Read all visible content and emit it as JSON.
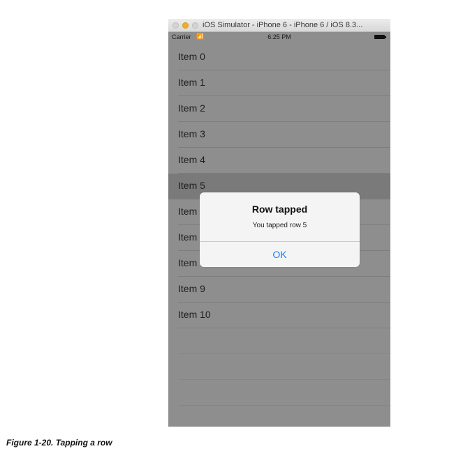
{
  "window": {
    "title": "iOS Simulator - iPhone 6 - iPhone 6 / iOS 8.3..."
  },
  "status_bar": {
    "carrier": "Carrier",
    "wifi_icon": "wifi-icon",
    "time": "6:25 PM",
    "battery_icon": "battery-icon"
  },
  "table": {
    "rows": [
      {
        "label": "Item 0"
      },
      {
        "label": "Item 1"
      },
      {
        "label": "Item 2"
      },
      {
        "label": "Item 3"
      },
      {
        "label": "Item 4"
      },
      {
        "label": "Item 5",
        "selected": true
      },
      {
        "label": "Item 6"
      },
      {
        "label": "Item 7"
      },
      {
        "label": "Item 8"
      },
      {
        "label": "Item 9"
      },
      {
        "label": "Item 10"
      }
    ]
  },
  "alert": {
    "title": "Row tapped",
    "message": "You tapped row 5",
    "ok_label": "OK",
    "ok_color": "#1a7cf5"
  },
  "caption": "Figure 1-20. Tapping a row"
}
